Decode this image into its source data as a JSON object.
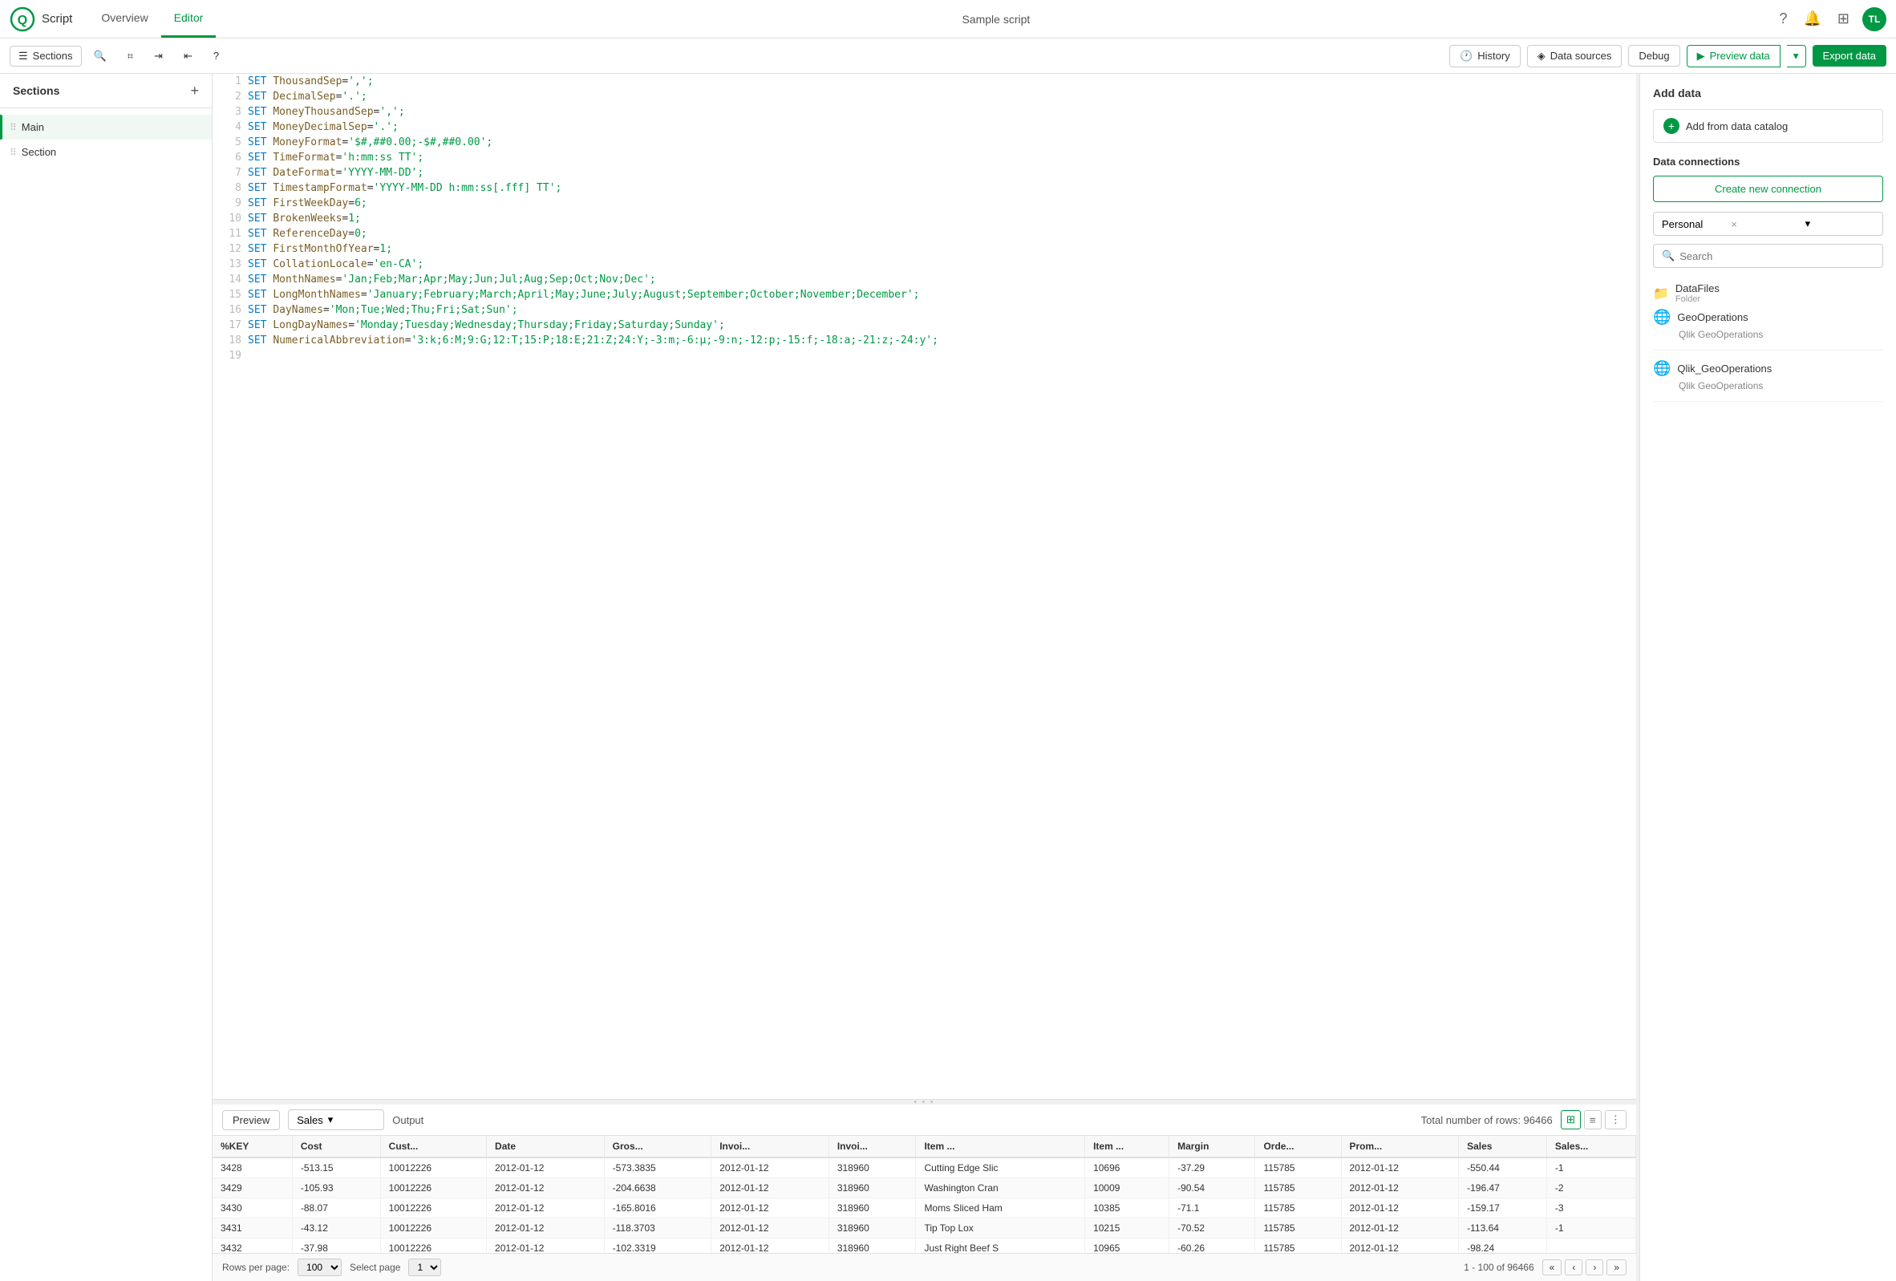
{
  "app": {
    "logo": "Q",
    "name": "Script",
    "nav_links": [
      "Overview",
      "Editor"
    ],
    "active_nav": "Editor",
    "center_title": "Sample script",
    "nav_icons": [
      "help",
      "bell",
      "grid"
    ],
    "avatar": "TL"
  },
  "toolbar": {
    "sections_label": "Sections",
    "history_label": "History",
    "data_sources_label": "Data sources",
    "debug_label": "Debug",
    "preview_data_label": "Preview data",
    "export_data_label": "Export data"
  },
  "sidebar": {
    "title": "Sections",
    "add_tooltip": "+",
    "items": [
      {
        "label": "Main",
        "active": true
      },
      {
        "label": "Section",
        "active": false
      }
    ]
  },
  "editor": {
    "lines": [
      {
        "num": 1,
        "code": "SET ThousandSep=',';"
      },
      {
        "num": 2,
        "code": "SET DecimalSep='.';"
      },
      {
        "num": 3,
        "code": "SET MoneyThousandSep=',';"
      },
      {
        "num": 4,
        "code": "SET MoneyDecimalSep='.';"
      },
      {
        "num": 5,
        "code": "SET MoneyFormat='$#,##0.00;-$#,##0.00';"
      },
      {
        "num": 6,
        "code": "SET TimeFormat='h:mm:ss TT';"
      },
      {
        "num": 7,
        "code": "SET DateFormat='YYYY-MM-DD';"
      },
      {
        "num": 8,
        "code": "SET TimestampFormat='YYYY-MM-DD h:mm:ss[.fff] TT';"
      },
      {
        "num": 9,
        "code": "SET FirstWeekDay=6;"
      },
      {
        "num": 10,
        "code": "SET BrokenWeeks=1;"
      },
      {
        "num": 11,
        "code": "SET ReferenceDay=0;"
      },
      {
        "num": 12,
        "code": "SET FirstMonthOfYear=1;"
      },
      {
        "num": 13,
        "code": "SET CollationLocale='en-CA';"
      },
      {
        "num": 14,
        "code": "SET MonthNames='Jan;Feb;Mar;Apr;May;Jun;Jul;Aug;Sep;Oct;Nov;Dec';"
      },
      {
        "num": 15,
        "code": "SET LongMonthNames='January;February;March;April;May;June;July;August;September;October;November;December';"
      },
      {
        "num": 16,
        "code": "SET DayNames='Mon;Tue;Wed;Thu;Fri;Sat;Sun';"
      },
      {
        "num": 17,
        "code": "SET LongDayNames='Monday;Tuesday;Wednesday;Thursday;Friday;Saturday;Sunday';"
      },
      {
        "num": 18,
        "code": "SET NumericalAbbreviation='3:k;6:M;9:G;12:T;15:P;18:E;21:Z;24:Y;-3:m;-6:μ;-9:n;-12:p;-15:f;-18:a;-21:z;-24:y';"
      },
      {
        "num": 19,
        "code": ""
      }
    ]
  },
  "right_panel": {
    "add_data_title": "Add data",
    "add_catalog_label": "Add from data catalog",
    "data_connections_title": "Data connections",
    "create_connection_label": "Create new connection",
    "dropdown_value": "Personal",
    "search_placeholder": "Search",
    "folder_label": "DataFiles",
    "folder_sub": "Folder",
    "connections": [
      {
        "name": "GeoOperations",
        "sub": "Qlik GeoOperations"
      },
      {
        "name": "Qlik_GeoOperations",
        "sub": "Qlik GeoOperations"
      }
    ]
  },
  "bottom": {
    "preview_label": "Preview",
    "sales_label": "Sales",
    "output_label": "Output",
    "total_rows_label": "Total number of rows: 96466",
    "columns": [
      "%KEY",
      "Cost",
      "Cust...",
      "Date",
      "Gros...",
      "Invoi...",
      "Invoi...",
      "Item ...",
      "Item ...",
      "Margin",
      "Orde...",
      "Prom...",
      "Sales",
      "Sales..."
    ],
    "rows": [
      [
        "3428",
        "-513.15",
        "10012226",
        "2012-01-12",
        "-573.3835",
        "2012-01-12",
        "318960",
        "Cutting Edge Slic",
        "10696",
        "-37.29",
        "115785",
        "2012-01-12",
        "-550.44",
        "-1"
      ],
      [
        "3429",
        "-105.93",
        "10012226",
        "2012-01-12",
        "-204.6638",
        "2012-01-12",
        "318960",
        "Washington Cran",
        "10009",
        "-90.54",
        "115785",
        "2012-01-12",
        "-196.47",
        "-2"
      ],
      [
        "3430",
        "-88.07",
        "10012226",
        "2012-01-12",
        "-165.8016",
        "2012-01-12",
        "318960",
        "Moms Sliced Ham",
        "10385",
        "-71.1",
        "115785",
        "2012-01-12",
        "-159.17",
        "-3"
      ],
      [
        "3431",
        "-43.12",
        "10012226",
        "2012-01-12",
        "-118.3703",
        "2012-01-12",
        "318960",
        "Tip Top Lox",
        "10215",
        "-70.52",
        "115785",
        "2012-01-12",
        "-113.64",
        "-1"
      ],
      [
        "3432",
        "-37.98",
        "10012226",
        "2012-01-12",
        "-102.3319",
        "2012-01-12",
        "318960",
        "Just Right Beef S",
        "10965",
        "-60.26",
        "115785",
        "2012-01-12",
        "-98.24",
        ""
      ]
    ],
    "rows_per_page_label": "Rows per page:",
    "rows_per_page_value": "100",
    "select_page_label": "Select page",
    "page_value": "1",
    "pagination_info": "1 - 100 of 96466"
  }
}
